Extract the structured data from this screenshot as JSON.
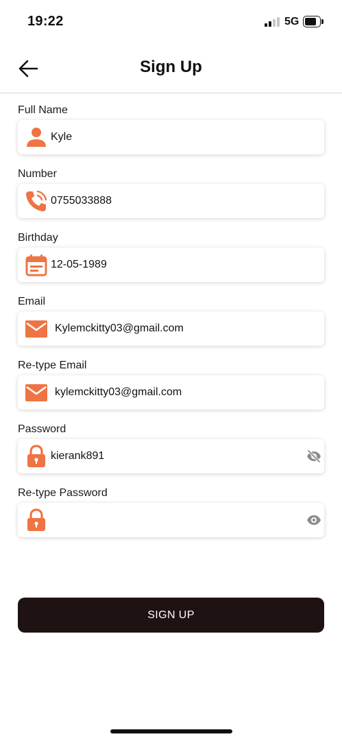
{
  "status_bar": {
    "time": "19:22",
    "network": "5G"
  },
  "header": {
    "title": "Sign Up"
  },
  "colors": {
    "accent": "#ef7443",
    "button": "#1e1213",
    "eye_icon": "#8c8c8c"
  },
  "fields": {
    "full_name": {
      "label": "Full Name",
      "value": "Kyle",
      "icon": "person-icon"
    },
    "number": {
      "label": "Number",
      "value": "0755033888",
      "icon": "phone-icon"
    },
    "birthday": {
      "label": "Birthday",
      "value": "12-05-1989",
      "icon": "calendar-icon"
    },
    "email": {
      "label": "Email",
      "value": "Kylemckitty03@gmail.com",
      "icon": "mail-icon"
    },
    "retype_email": {
      "label": "Re-type Email",
      "value": "kylemckitty03@gmail.com",
      "icon": "mail-icon"
    },
    "password": {
      "label": "Password",
      "value": "kierank891",
      "icon": "lock-icon",
      "visibility_icon": "eye-off-icon"
    },
    "retype_password": {
      "label": "Re-type Password",
      "value": "",
      "icon": "lock-icon",
      "visibility_icon": "eye-icon"
    }
  },
  "signup_button": {
    "label": "SIGN UP"
  }
}
